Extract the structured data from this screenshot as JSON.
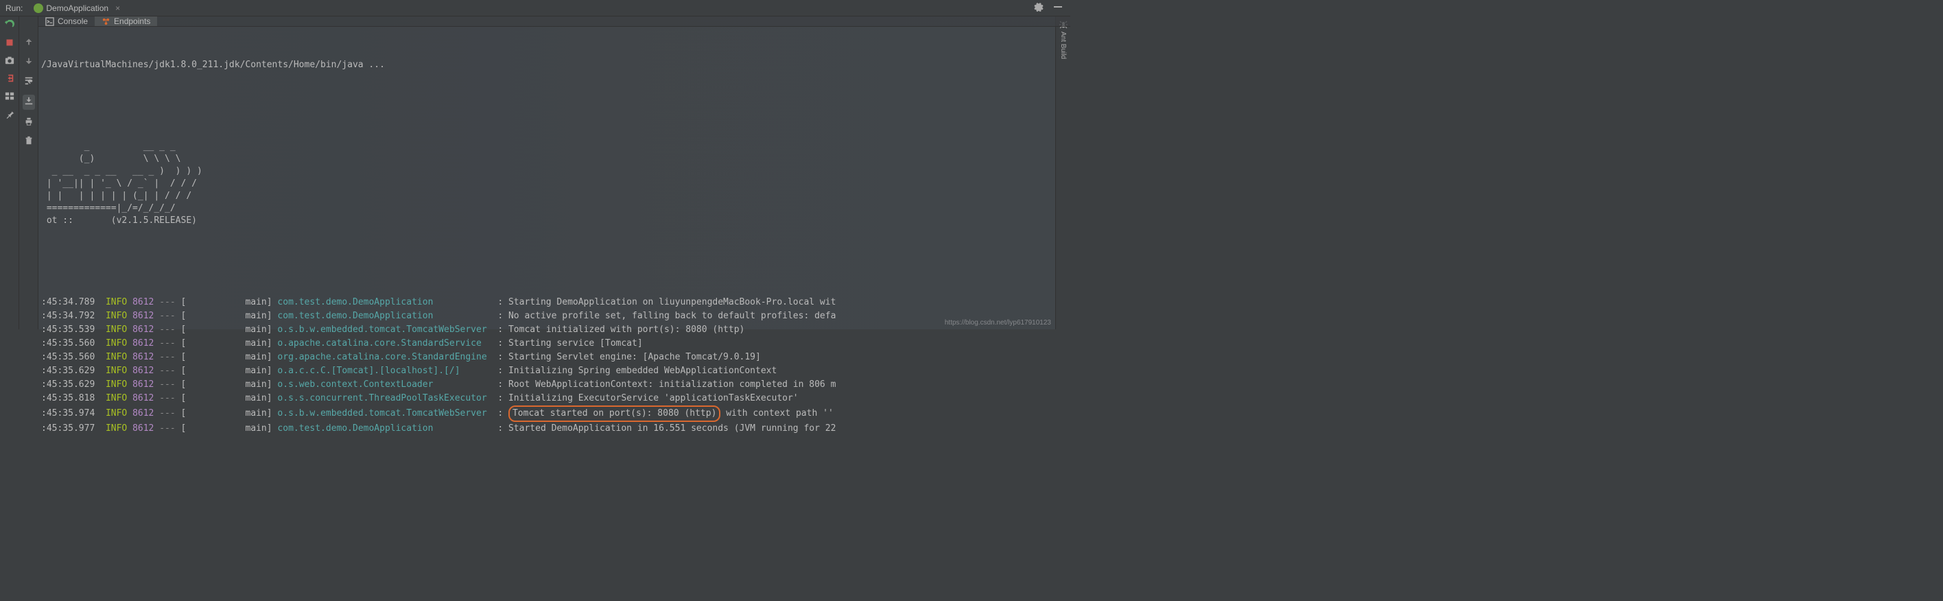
{
  "header": {
    "run_label": "Run:",
    "config_name": "DemoApplication"
  },
  "tabs": {
    "console": "Console",
    "endpoints": "Endpoints"
  },
  "right_sidebar": {
    "ant_build": "Ant Build"
  },
  "console": {
    "command": "/JavaVirtualMachines/jdk1.8.0_211.jdk/Contents/Home/bin/java ...",
    "ascii": [
      "        _          __ _ _",
      "       (_)         \\ \\ \\ \\",
      "  _ __  _ _ __   __ _ )  ) ) )",
      " | '__|| | '_ \\ / _` |  / / /",
      " | |   | | | | | (_| | / / / ",
      " =============|_/=/_/_/_/",
      " ot ::       (v2.1.5.RELEASE)"
    ],
    "logs": [
      {
        "ts": ":45:34.789",
        "level": "INFO",
        "pid": "8612",
        "sep": "---",
        "thread": "[           main]",
        "logger": "com.test.demo.DemoApplication           ",
        "msg": "Starting DemoApplication on liuyunpengdeMacBook-Pro.local wit",
        "hl": false
      },
      {
        "ts": ":45:34.792",
        "level": "INFO",
        "pid": "8612",
        "sep": "---",
        "thread": "[           main]",
        "logger": "com.test.demo.DemoApplication           ",
        "msg": "No active profile set, falling back to default profiles: defa",
        "hl": false
      },
      {
        "ts": ":45:35.539",
        "level": "INFO",
        "pid": "8612",
        "sep": "---",
        "thread": "[           main]",
        "logger": "o.s.b.w.embedded.tomcat.TomcatWebServer ",
        "msg": "Tomcat initialized with port(s): 8080 (http)",
        "hl": false
      },
      {
        "ts": ":45:35.560",
        "level": "INFO",
        "pid": "8612",
        "sep": "---",
        "thread": "[           main]",
        "logger": "o.apache.catalina.core.StandardService  ",
        "msg": "Starting service [Tomcat]",
        "hl": false
      },
      {
        "ts": ":45:35.560",
        "level": "INFO",
        "pid": "8612",
        "sep": "---",
        "thread": "[           main]",
        "logger": "org.apache.catalina.core.StandardEngine ",
        "msg": "Starting Servlet engine: [Apache Tomcat/9.0.19]",
        "hl": false
      },
      {
        "ts": ":45:35.629",
        "level": "INFO",
        "pid": "8612",
        "sep": "---",
        "thread": "[           main]",
        "logger": "o.a.c.c.C.[Tomcat].[localhost].[/]      ",
        "msg": "Initializing Spring embedded WebApplicationContext",
        "hl": false
      },
      {
        "ts": ":45:35.629",
        "level": "INFO",
        "pid": "8612",
        "sep": "---",
        "thread": "[           main]",
        "logger": "o.s.web.context.ContextLoader           ",
        "msg": "Root WebApplicationContext: initialization completed in 806 m",
        "hl": false
      },
      {
        "ts": ":45:35.818",
        "level": "INFO",
        "pid": "8612",
        "sep": "---",
        "thread": "[           main]",
        "logger": "o.s.s.concurrent.ThreadPoolTaskExecutor ",
        "msg": "Initializing ExecutorService 'applicationTaskExecutor'",
        "hl": false
      },
      {
        "ts": ":45:35.974",
        "level": "INFO",
        "pid": "8612",
        "sep": "---",
        "thread": "[           main]",
        "logger": "o.s.b.w.embedded.tomcat.TomcatWebServer ",
        "msg_pre": "",
        "msg_hl": "Tomcat started on port(s): 8080 (http)",
        "msg_post": " with context path ''",
        "hl": true
      },
      {
        "ts": ":45:35.977",
        "level": "INFO",
        "pid": "8612",
        "sep": "---",
        "thread": "[           main]",
        "logger": "com.test.demo.DemoApplication           ",
        "msg": "Started DemoApplication in 16.551 seconds (JVM running for 22",
        "hl": false
      }
    ]
  },
  "watermark": "https://blog.csdn.net/lyp617910123"
}
